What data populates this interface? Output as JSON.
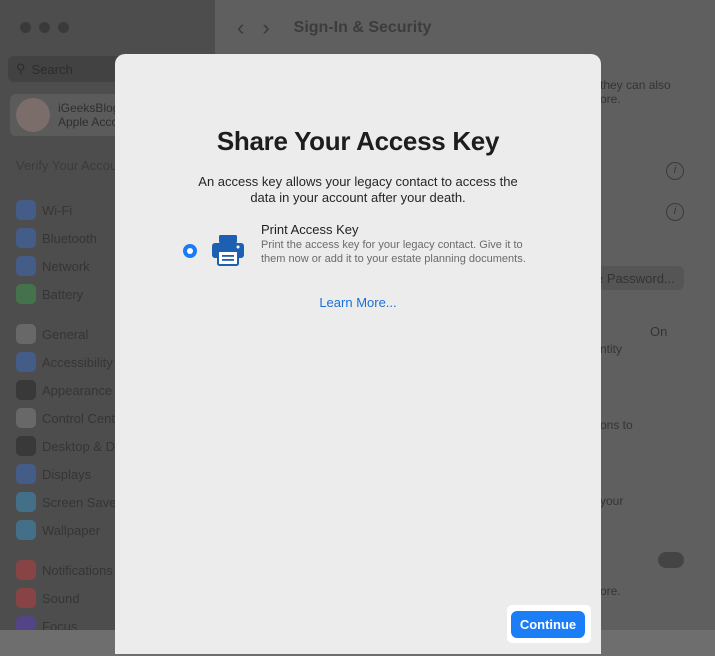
{
  "window": {
    "title": "Sign-In & Security",
    "back_icon": "chevron-left-icon",
    "forward_icon": "chevron-right-icon"
  },
  "sidebar": {
    "search_placeholder": "Search",
    "profile_name": "iGeeksBlog",
    "profile_sub": "Apple Account",
    "verify_text": "Verify Your Account",
    "items": [
      {
        "label": "Wi-Fi",
        "color": "#3a6fd1"
      },
      {
        "label": "Bluetooth",
        "color": "#3a6fd1"
      },
      {
        "label": "Network",
        "color": "#3a6fd1"
      },
      {
        "label": "Battery",
        "color": "#3aa04a"
      },
      {
        "label": "General",
        "color": "#8a8a8a"
      },
      {
        "label": "Accessibility",
        "color": "#3a6fd1"
      },
      {
        "label": "Appearance",
        "color": "#222222"
      },
      {
        "label": "Control Centre",
        "color": "#8a8a8a"
      },
      {
        "label": "Desktop & Dock",
        "color": "#222222"
      },
      {
        "label": "Displays",
        "color": "#3a6fd1"
      },
      {
        "label": "Screen Saver",
        "color": "#3a9ad1"
      },
      {
        "label": "Wallpaper",
        "color": "#3a9ad1"
      },
      {
        "label": "Notifications",
        "color": "#d13a3a"
      },
      {
        "label": "Sound",
        "color": "#d13a3a"
      },
      {
        "label": "Focus",
        "color": "#5a3ad1"
      }
    ]
  },
  "background_right": {
    "snip1": "they can also",
    "snip2": "ore.",
    "password_button": "e Password...",
    "on_label": "On",
    "snip3": "ntity",
    "snip4": "ons to",
    "snip5": "your",
    "snip6": "ore."
  },
  "sheet": {
    "title": "Share Your Access Key",
    "description": "An access key allows your legacy contact to access the data in your account after your death.",
    "option_title": "Print Access Key",
    "option_description": "Print the access key for your legacy contact. Give it to them now or add it to your estate planning documents.",
    "option_icon": "printer-icon",
    "learn_more": "Learn More...",
    "continue_label": "Continue",
    "accent_color": "#1b7ef6"
  }
}
